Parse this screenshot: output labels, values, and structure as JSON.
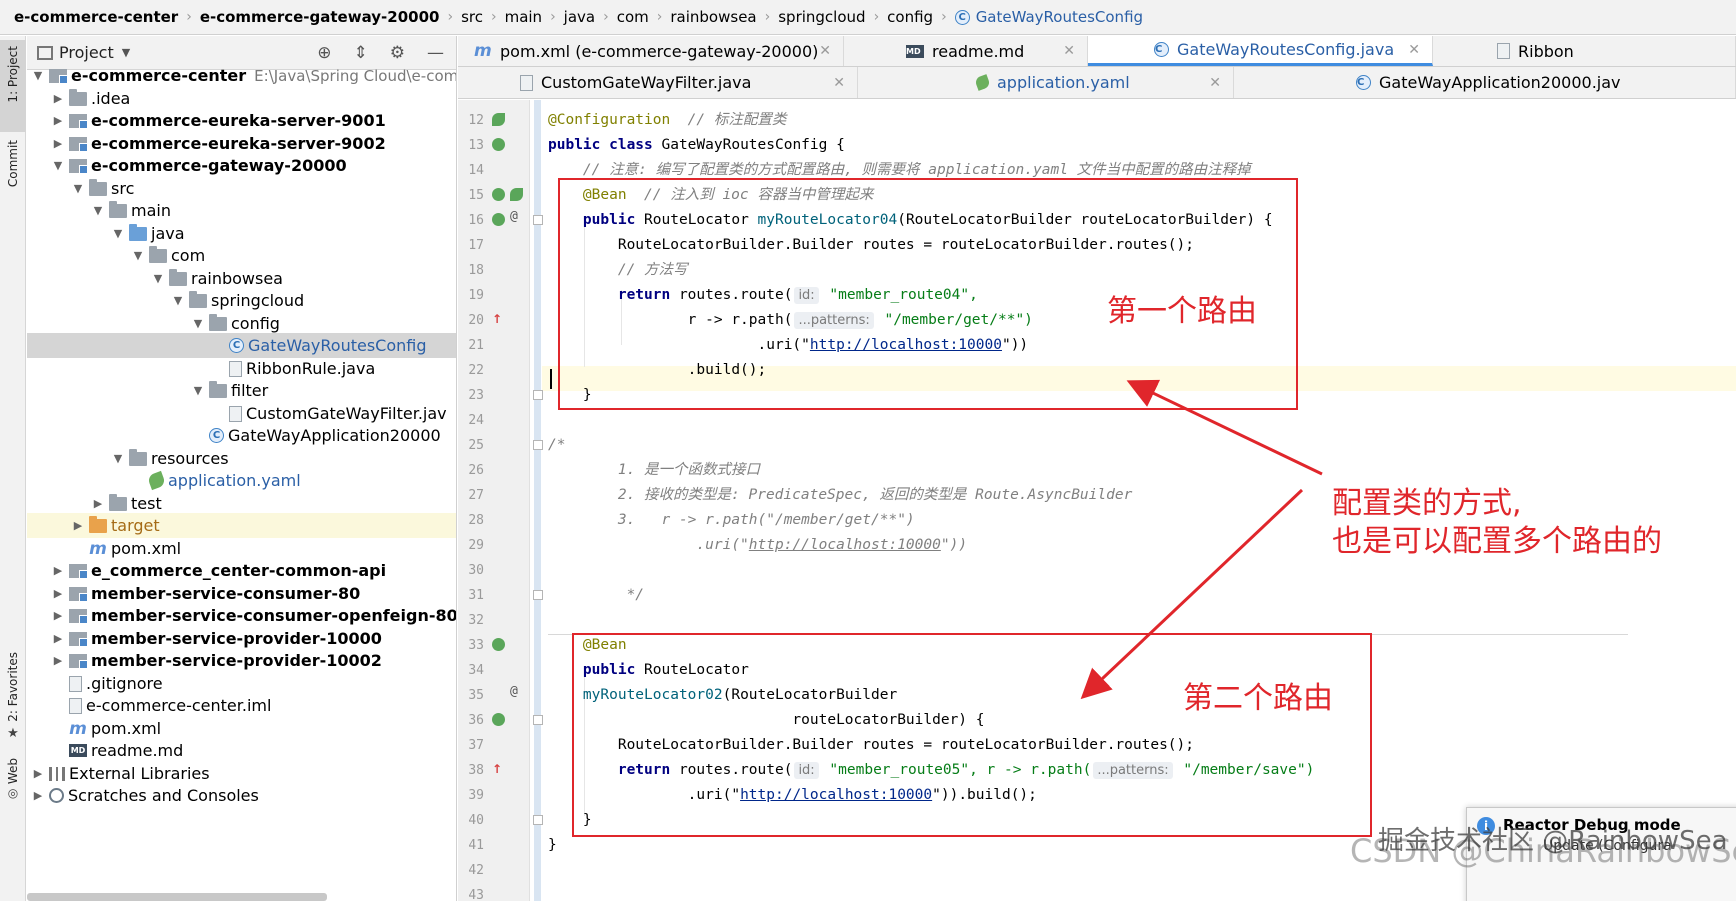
{
  "breadcrumb": [
    "e-commerce-center",
    "e-commerce-gateway-20000",
    "src",
    "main",
    "java",
    "com",
    "rainbowsea",
    "springcloud",
    "config",
    "GateWayRoutesConfig"
  ],
  "sidebar_tabs": {
    "project": "1: Project",
    "commit": "Commit",
    "favorites": "2: Favorites",
    "web": "Web"
  },
  "project_panel": {
    "title": "Project",
    "tree": [
      {
        "label": "e-commerce-center",
        "extra": "E:\\Java\\Spring Cloud\\e-comme",
        "bold": true
      },
      {
        "label": ".idea"
      },
      {
        "label": "e-commerce-eureka-server-9001",
        "bold": true
      },
      {
        "label": "e-commerce-eureka-server-9002",
        "bold": true
      },
      {
        "label": "e-commerce-gateway-20000",
        "bold": true
      },
      {
        "label": "src"
      },
      {
        "label": "main"
      },
      {
        "label": "java"
      },
      {
        "label": "com"
      },
      {
        "label": "rainbowsea"
      },
      {
        "label": "springcloud"
      },
      {
        "label": "config"
      },
      {
        "label": "GateWayRoutesConfig"
      },
      {
        "label": "RibbonRule.java"
      },
      {
        "label": "filter"
      },
      {
        "label": "CustomGateWayFilter.jav"
      },
      {
        "label": "GateWayApplication20000"
      },
      {
        "label": "resources"
      },
      {
        "label": "application.yaml"
      },
      {
        "label": "test"
      },
      {
        "label": "target"
      },
      {
        "label": "pom.xml"
      },
      {
        "label": "e_commerce_center-common-api",
        "bold": true
      },
      {
        "label": "member-service-consumer-80",
        "bold": true
      },
      {
        "label": "member-service-consumer-openfeign-80",
        "bold": true
      },
      {
        "label": "member-service-provider-10000",
        "bold": true
      },
      {
        "label": "member-service-provider-10002",
        "bold": true
      },
      {
        "label": ".gitignore"
      },
      {
        "label": "e-commerce-center.iml"
      },
      {
        "label": "pom.xml"
      },
      {
        "label": "readme.md"
      },
      {
        "label": "External Libraries"
      },
      {
        "label": "Scratches and Consoles"
      }
    ]
  },
  "tabs_row1": [
    "pom.xml (e-commerce-gateway-20000)",
    "readme.md",
    "GateWayRoutesConfig.java",
    "Ribbon"
  ],
  "tabs_row2": [
    "CustomGateWayFilter.java",
    "application.yaml",
    "GateWayApplication20000.jav"
  ],
  "line_numbers": [
    "12",
    "13",
    "14",
    "15",
    "16",
    "17",
    "18",
    "19",
    "20",
    "21",
    "22",
    "23",
    "24",
    "25",
    "26",
    "27",
    "28",
    "29",
    "30",
    "31",
    "32",
    "33",
    "34",
    "35",
    "36",
    "37",
    "38",
    "39",
    "40",
    "41",
    "42",
    "43"
  ],
  "code": {
    "l12a": "@Configuration",
    "l12b": "  // 标注配置类",
    "l13a": "public class",
    "l13b": " GateWayRoutesConfig {",
    "l14": "    // 注意: 编写了配置类的方式配置路由, 则需要将 application.yaml 文件当中配置的路由注释掉",
    "l15a": "    @Bean",
    "l15b": "  // 注入到 ioc 容器当中管理起来",
    "l16a": "    public",
    "l16b": " RouteLocator ",
    "l16c": "myRouteLocator04",
    "l16d": "(RouteLocatorBuilder routeLocatorBuilder) {",
    "l17": "        RouteLocatorBuilder.Builder routes = routeLocatorBuilder.routes();",
    "l18": "        // 方法写",
    "l19a": "        return",
    "l19b": " routes.route(",
    "l19hint": "id:",
    "l19c": " \"member_route04\",",
    "l20a": "                r -> r.path(",
    "l20hint": "...patterns:",
    "l20b": " \"/member/get/**\")",
    "l21a": "                        .uri(\"",
    "l21url": "http://localhost:10000",
    "l21b": "\"))",
    "l22": "                .build();",
    "l23": "    }",
    "l25": "/*",
    "l26": "        1. 是一个函数式接口",
    "l27": "        2. 接收的类型是: PredicateSpec, 返回的类型是 Route.AsyncBuilder",
    "l28": "        3.   r -> r.path(\"/member/get/**\")",
    "l29a": "                 .uri(\"",
    "l29url": "http://localhost:10000",
    "l29b": "\"))",
    "l31": "         */",
    "l33": "    @Bean",
    "l34a": "    public",
    "l34b": " RouteLocator",
    "l35": "    myRouteLocator02",
    "l35b": "(RouteLocatorBuilder",
    "l36": "                            routeLocatorBuilder) {",
    "l37": "        RouteLocatorBuilder.Builder routes = routeLocatorBuilder.routes();",
    "l38a": "        return",
    "l38b": " routes.route(",
    "l38hint1": "id:",
    "l38c": " \"member_route05\", r -> r.path(",
    "l38hint2": "...patterns:",
    "l38d": " \"/member/save\")",
    "l39a": "                .uri(\"",
    "l39url": "http://localhost:10000",
    "l39b": "\")).build();",
    "l40": "    }",
    "l41": "}"
  },
  "annotations": {
    "route1": "第一个路由",
    "route2": "第二个路由",
    "note_line1": "配置类的方式,",
    "note_line2": "也是可以配置多个路由的"
  },
  "popup": {
    "title": "Reactor Debug mode",
    "body": "Update (Configura"
  },
  "watermark": "CSDN @ChinaRainbowSea",
  "watermark2": "掘金技术社区 @RainbowSea"
}
